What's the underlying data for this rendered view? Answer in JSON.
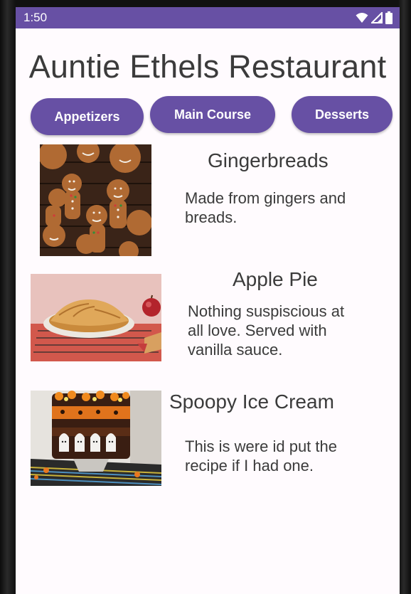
{
  "status_bar": {
    "time": "1:50",
    "icons": [
      "wifi-icon",
      "signal-icon",
      "battery-icon"
    ],
    "color": "#6750a4"
  },
  "app": {
    "title": "Auntie Ethels Restaurant"
  },
  "tabs": [
    {
      "label": "Appetizers"
    },
    {
      "label": "Main Course"
    },
    {
      "label": "Desserts"
    }
  ],
  "menu_items": [
    {
      "name": "Gingerbreads",
      "description": "Made from gingers and breads.",
      "image": "gingerbread-image"
    },
    {
      "name": "Apple Pie",
      "description": "Nothing suspiscious at all love. Served with vanilla sauce.",
      "image": "apple-pie-image"
    },
    {
      "name": "Spoopy Ice Cream",
      "description": "This is were id put the recipe if I had one.",
      "image": "ice-cream-image"
    }
  ],
  "colors": {
    "accent": "#6750a4",
    "background": "#fffbfe",
    "text": "#3b3b3b"
  }
}
